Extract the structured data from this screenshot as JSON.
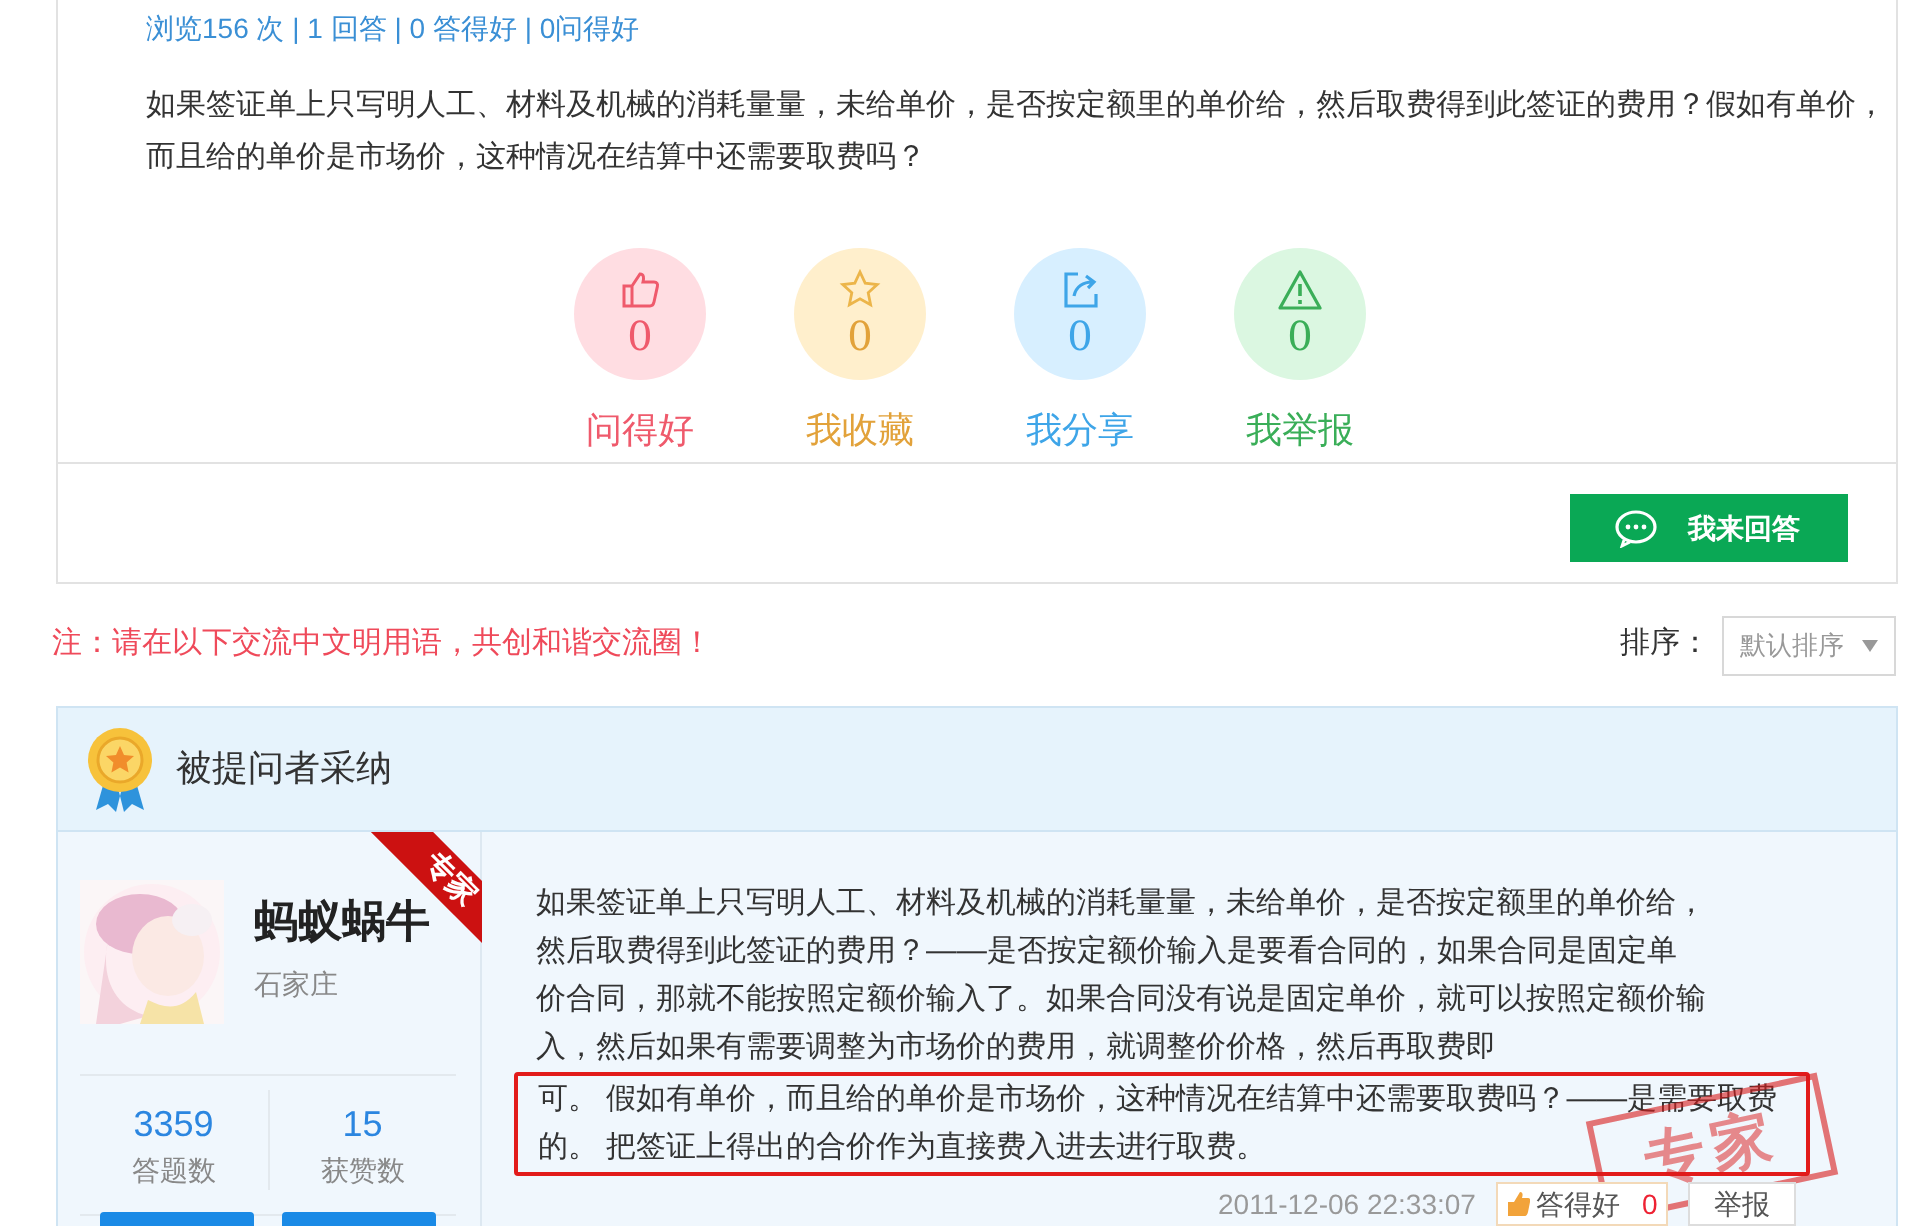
{
  "question": {
    "stats": "浏览156 次 | 1 回答 | 0 答得好 | 0问得好",
    "text": "如果签证单上只写明人工、材料及机械的消耗量量，未给单价，是否按定额里的单价给，然后取费得到此签证的费用？假如有单价，而且给的单价是市场价，这种情况在结算中还需要取费吗？",
    "actions": [
      {
        "kind": "like",
        "count": "0",
        "label": "问得好"
      },
      {
        "kind": "favorite",
        "count": "0",
        "label": "我收藏"
      },
      {
        "kind": "share",
        "count": "0",
        "label": "我分享"
      },
      {
        "kind": "report",
        "count": "0",
        "label": "我举报"
      }
    ],
    "answer_button": "我来回答"
  },
  "notice": "注：请在以下交流中文明用语，共创和谐交流圈！",
  "sort": {
    "label": "排序：",
    "value": "默认排序"
  },
  "adopted": {
    "title": "被提问者采纳",
    "user": {
      "name": "蚂蚁蜗牛",
      "location": "石家庄",
      "badge": "专家",
      "stats": [
        {
          "value": "3359",
          "label": "答题数"
        },
        {
          "value": "15",
          "label": "获赞数"
        }
      ]
    },
    "answer_text": "如果签证单上只写明人工、材料及机械的消耗量量，未给单价，是否按定额里的单价给，然后取费得到此签证的费用？——是否按定额价输入是要看合同的，如果合同是固定单价合同，那就不能按照定额价输入了。如果合同没有说是固定单价，就可以按照定额价输入，然后如果有需要调整为市场价的费用，就调整价价格，然后再取费即",
    "highlighted_text": "可。 假如有单价，而且给的单价是市场价，这种情况在结算中还需要取费吗？——是需要取费的。 把签证上得出的合价作为直接费入进去进行取费。",
    "stamp": "专家",
    "date": "2011-12-06 22:33:07",
    "like_label": "答得好",
    "like_count": "0",
    "report": "举报"
  }
}
